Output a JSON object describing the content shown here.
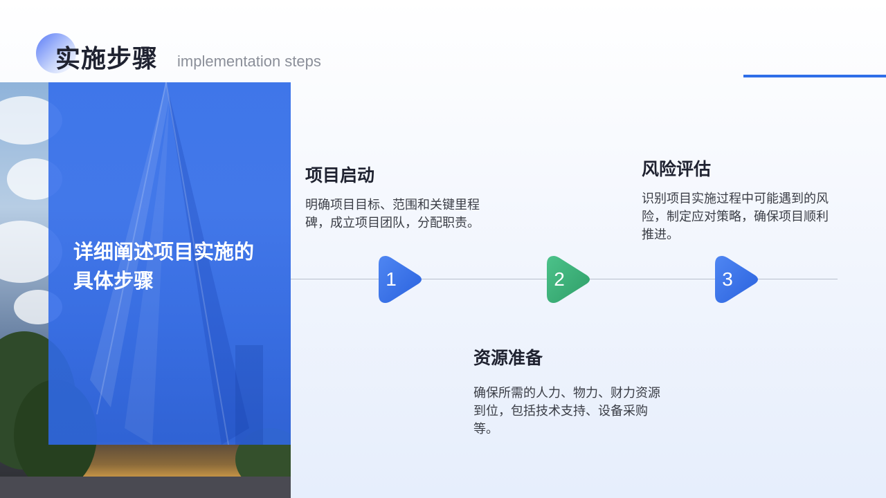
{
  "header": {
    "title": "实施步骤",
    "subtitle": "implementation steps",
    "accent_color": "#2f6ee8"
  },
  "hero": {
    "text_line1": "详细阐述项目实施的",
    "text_line2": "具体步骤",
    "overlay_color": "#346eeb"
  },
  "steps": [
    {
      "number": "1",
      "title": "项目启动",
      "description": "明确项目目标、范围和关键里程碑，成立项目团队，分配职责。",
      "color": "#2f6ee8"
    },
    {
      "number": "2",
      "title": "资源准备",
      "description": "确保所需的人力、物力、财力资源到位，包括技术支持、设备采购等。",
      "color": "#3bb37a"
    },
    {
      "number": "3",
      "title": "风险评估",
      "description": "识别项目实施过程中可能遇到的风险，制定应对策略，确保项目顺利推进。",
      "color": "#2f6ee8"
    }
  ]
}
